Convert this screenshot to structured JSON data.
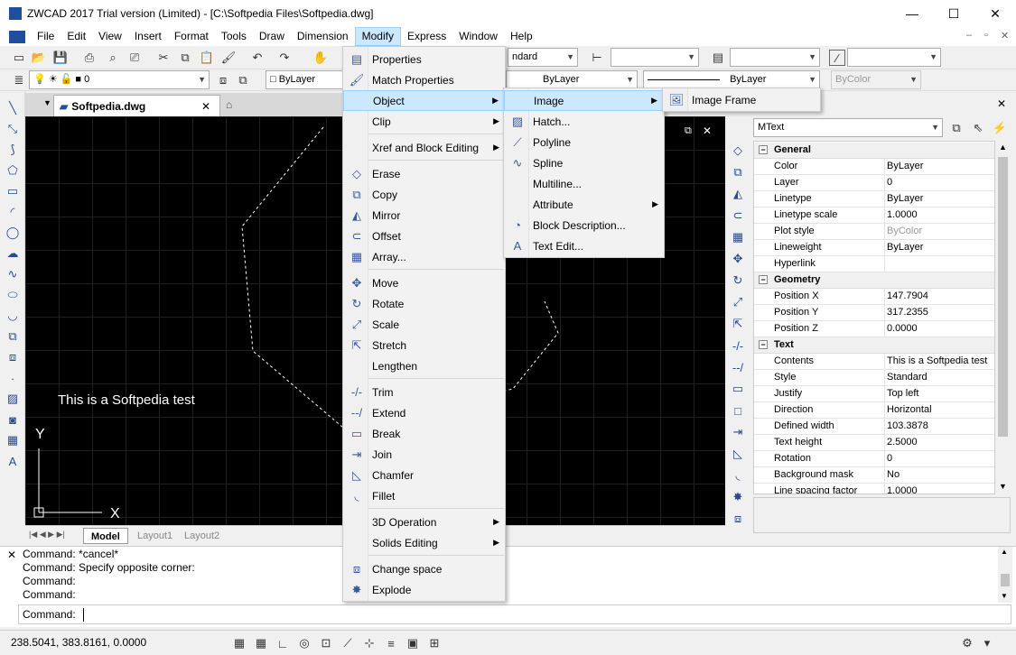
{
  "window": {
    "title": "ZWCAD 2017 Trial version (Limited) - [C:\\Softpedia Files\\Softpedia.dwg]",
    "minimize": "—",
    "maximize": "☐",
    "close": "✕"
  },
  "menubar": [
    "File",
    "Edit",
    "View",
    "Insert",
    "Format",
    "Tools",
    "Draw",
    "Dimension",
    "Modify",
    "Express",
    "Window",
    "Help"
  ],
  "toolbar": {
    "layer": "0",
    "color": "ByLayer",
    "linetype": "ByLayer",
    "lineweight": "ByLayer",
    "plotstyle": "ByColor",
    "textstyle_tail": "ndard"
  },
  "document": {
    "tab": "Softpedia.dwg",
    "canvas_text": "This is a Softpedia test",
    "ucs_x": "X",
    "ucs_y": "Y"
  },
  "layout_tabs": [
    "Model",
    "Layout1",
    "Layout2"
  ],
  "modify_menu": {
    "items": [
      {
        "label": "Properties",
        "icon": "properties-icon"
      },
      {
        "label": "Match Properties",
        "icon": "match-properties-icon"
      },
      {
        "label": "Object",
        "submenu": true
      },
      {
        "label": "Clip",
        "submenu": true
      },
      {
        "label": "Xref and Block Editing",
        "submenu": true
      },
      {
        "label": "Erase",
        "icon": "erase-icon"
      },
      {
        "label": "Copy",
        "icon": "copy-icon"
      },
      {
        "label": "Mirror",
        "icon": "mirror-icon"
      },
      {
        "label": "Offset",
        "icon": "offset-icon"
      },
      {
        "label": "Array...",
        "icon": "array-icon"
      },
      {
        "label": "Move",
        "icon": "move-icon"
      },
      {
        "label": "Rotate",
        "icon": "rotate-icon"
      },
      {
        "label": "Scale",
        "icon": "scale-icon"
      },
      {
        "label": "Stretch",
        "icon": "stretch-icon"
      },
      {
        "label": "Lengthen"
      },
      {
        "label": "Trim",
        "icon": "trim-icon"
      },
      {
        "label": "Extend",
        "icon": "extend-icon"
      },
      {
        "label": "Break",
        "icon": "break-icon"
      },
      {
        "label": "Join",
        "icon": "join-icon"
      },
      {
        "label": "Chamfer",
        "icon": "chamfer-icon"
      },
      {
        "label": "Fillet",
        "icon": "fillet-icon"
      },
      {
        "label": "3D Operation",
        "submenu": true
      },
      {
        "label": "Solids Editing",
        "submenu": true
      },
      {
        "label": "Change space",
        "icon": "change-space-icon"
      },
      {
        "label": "Explode",
        "icon": "explode-icon"
      }
    ]
  },
  "object_submenu": [
    "Image",
    "Hatch...",
    "Polyline",
    "Spline",
    "Multiline...",
    "Attribute",
    "Block Description...",
    "Text Edit..."
  ],
  "image_submenu": [
    "Image Frame"
  ],
  "properties": {
    "selector": "MText",
    "general": {
      "title": "General",
      "rows": [
        [
          "Color",
          "ByLayer"
        ],
        [
          "Layer",
          "0"
        ],
        [
          "Linetype",
          "ByLayer"
        ],
        [
          "Linetype scale",
          "1.0000"
        ],
        [
          "Plot style",
          "ByColor"
        ],
        [
          "Lineweight",
          "ByLayer"
        ],
        [
          "Hyperlink",
          ""
        ]
      ]
    },
    "geometry": {
      "title": "Geometry",
      "rows": [
        [
          "Position X",
          "147.7904"
        ],
        [
          "Position Y",
          "317.2355"
        ],
        [
          "Position Z",
          "0.0000"
        ]
      ]
    },
    "text": {
      "title": "Text",
      "rows": [
        [
          "Contents",
          "This is a Softpedia test"
        ],
        [
          "Style",
          "Standard"
        ],
        [
          "Justify",
          "Top left"
        ],
        [
          "Direction",
          "Horizontal"
        ],
        [
          "Defined width",
          "103.3878"
        ],
        [
          "Text height",
          "2.5000"
        ],
        [
          "Rotation",
          "0"
        ],
        [
          "Background mask",
          "No"
        ],
        [
          "Line spacing factor",
          "1.0000"
        ]
      ]
    }
  },
  "command": {
    "lines": [
      "Command: *cancel*",
      "Command: Specify opposite corner:",
      "Command:",
      "Command:"
    ],
    "prompt": "Command:"
  },
  "status": {
    "coords": "238.5041, 383.8161, 0.0000"
  }
}
